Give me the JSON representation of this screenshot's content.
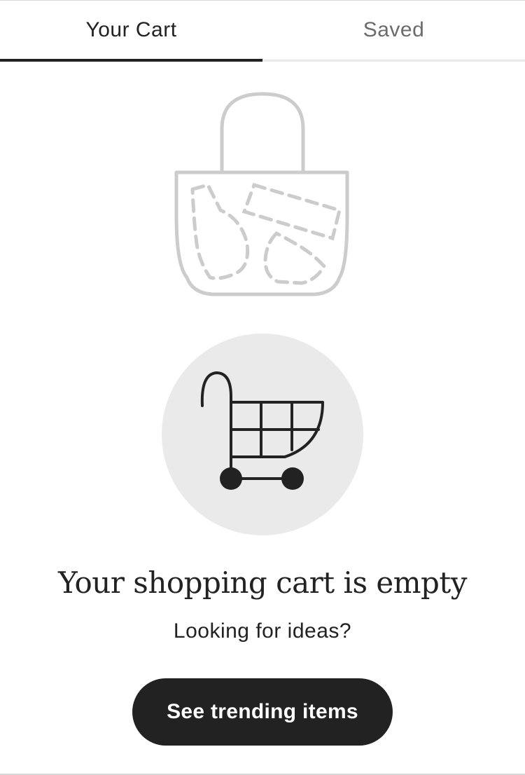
{
  "tabs": [
    {
      "label": "Your Cart",
      "active": true
    },
    {
      "label": "Saved",
      "active": false
    }
  ],
  "illustration": {
    "icon": "shopping-bag-icon",
    "color": "#cccccc"
  },
  "cart_badge": {
    "icon": "shopping-cart-icon",
    "background": "#eaeaea",
    "color": "#222222"
  },
  "empty_state": {
    "headline": "Your shopping cart is empty",
    "subtext": "Looking for ideas?",
    "cta_label": "See trending items"
  },
  "colors": {
    "text": "#222222",
    "muted_text": "#6b6b6b",
    "button_bg": "#222222",
    "button_text": "#ffffff"
  }
}
